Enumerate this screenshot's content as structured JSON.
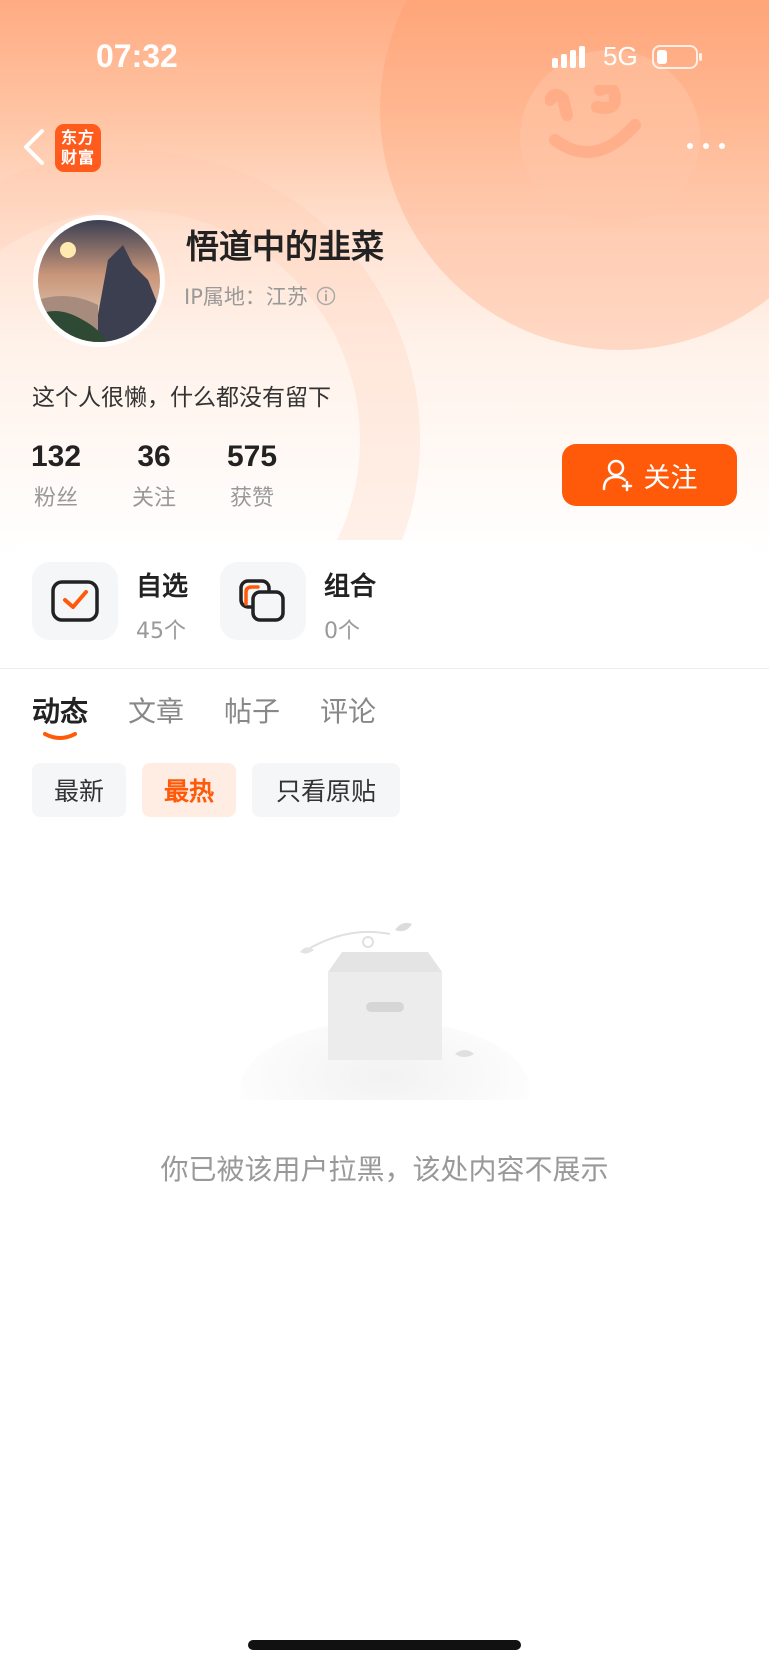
{
  "status_bar": {
    "time": "07:32",
    "network": "5G"
  },
  "header": {
    "logo_text_line1": "东方",
    "logo_text_line2": "财富"
  },
  "profile": {
    "username": "悟道中的韭菜",
    "ip_location": "IP属地：江苏",
    "bio": "这个人很懒，什么都没有留下"
  },
  "stats": [
    {
      "value": "132",
      "label": "粉丝"
    },
    {
      "value": "36",
      "label": "关注"
    },
    {
      "value": "575",
      "label": "获赞"
    }
  ],
  "follow_button": {
    "label": "关注"
  },
  "quick_items": [
    {
      "title": "自选",
      "count": "45个"
    },
    {
      "title": "组合",
      "count": "0个"
    }
  ],
  "tabs": [
    {
      "label": "动态",
      "active": true
    },
    {
      "label": "文章",
      "active": false
    },
    {
      "label": "帖子",
      "active": false
    },
    {
      "label": "评论",
      "active": false
    }
  ],
  "filters": [
    {
      "label": "最新",
      "active": false
    },
    {
      "label": "最热",
      "active": true
    },
    {
      "label": "只看原贴",
      "active": false
    }
  ],
  "empty_state": {
    "message": "你已被该用户拉黑，该处内容不展示"
  },
  "colors": {
    "accent": "#ff5a0a",
    "accent_light": "#ffede3"
  }
}
